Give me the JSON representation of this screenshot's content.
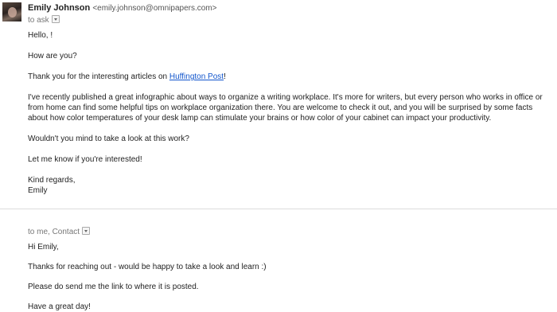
{
  "message1": {
    "sender_name": "Emily Johnson",
    "sender_email": "<emily.johnson@omnipapers.com>",
    "recipients": "to ask",
    "greeting": "Hello,          !",
    "line1": "How are you?",
    "line2_prefix": "Thank you for the interesting articles on ",
    "line2_link": "Huffington Post",
    "line2_suffix": "!",
    "paragraph": "I've recently published a great infographic about ways to organize a writing workplace. It's more for writers, but every person who works in office or from home can find some helpful tips on workplace organization there. You are welcome to check it out, and you will be surprised by some facts about how color temperatures of your desk lamp can stimulate your brains or how color of your cabinet can impact your productivity.",
    "question": "Wouldn't you mind to take a look at this work?",
    "cta": "Let me know if you're interested!",
    "closing": "Kind regards,",
    "signature": "Emily"
  },
  "message2": {
    "recipients": "to me, Contact",
    "greeting": "Hi Emily,",
    "line1": "Thanks for reaching out - would be happy to take a look and learn :)",
    "line2": "Please do send me the link to where it is posted.",
    "line3": "Have a great day!"
  },
  "colors": {
    "link": "#1155cc",
    "text": "#222222",
    "meta": "#777777"
  }
}
